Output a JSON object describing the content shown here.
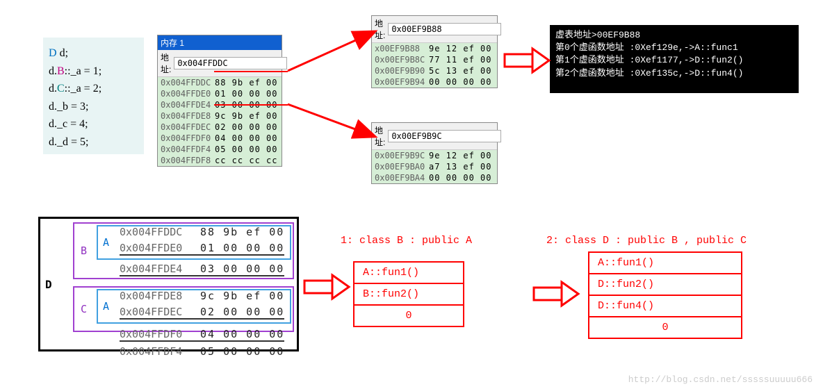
{
  "code": {
    "line1_type": "D",
    "line1_rest": " d;",
    "line2_pre": "d.",
    "line2_cls": "B",
    "line2_rest": "::_a = 1;",
    "line3_pre": "d.",
    "line3_cls": "C",
    "line3_rest": "::_a = 2;",
    "line4": "d._b = 3;",
    "line5": "d._c = 4;",
    "line6": "d._d = 5;"
  },
  "mem1": {
    "title": "内存 1",
    "addr_label": "地址:",
    "addr_value": "0x004FFDDC",
    "rows": [
      {
        "addr": "0x004FFDDC",
        "bytes": "88 9b ef 00"
      },
      {
        "addr": "0x004FFDE0",
        "bytes": "01 00 00 00"
      },
      {
        "addr": "0x004FFDE4",
        "bytes": "03 00 00 00"
      },
      {
        "addr": "0x004FFDE8",
        "bytes": "9c 9b ef 00"
      },
      {
        "addr": "0x004FFDEC",
        "bytes": "02 00 00 00"
      },
      {
        "addr": "0x004FFDF0",
        "bytes": "04 00 00 00"
      },
      {
        "addr": "0x004FFDF4",
        "bytes": "05 00 00 00"
      },
      {
        "addr": "0x004FFDF8",
        "bytes": "cc cc cc cc"
      }
    ]
  },
  "mem2": {
    "addr_label": "地址:",
    "addr_value": "0x00EF9B88",
    "rows": [
      {
        "addr": "x00EF9B88",
        "bytes": "9e 12 ef 00"
      },
      {
        "addr": "0x00EF9B8C",
        "bytes": "77 11 ef 00"
      },
      {
        "addr": "0x00EF9B90",
        "bytes": "5c 13 ef 00"
      },
      {
        "addr": "0x00EF9B94",
        "bytes": "00 00 00 00"
      }
    ]
  },
  "mem3": {
    "addr_label": "地址:",
    "addr_value": "0x00EF9B9C",
    "rows": [
      {
        "addr": "0x00EF9B9C",
        "bytes": "9e 12 ef 00"
      },
      {
        "addr": "0x00EF9BA0",
        "bytes": "a7 13 ef 00"
      },
      {
        "addr": "0x00EF9BA4",
        "bytes": "00 00 00 00"
      }
    ]
  },
  "terminal": {
    "line1": "虚表地址>00EF9B88",
    "line2": "第0个虚函数地址 :0Xef129e,->A::func1",
    "line3": "第1个虚函数地址 :0Xef1177,->D::fun2()",
    "line4": "第2个虚函数地址 :0Xef135c,->D::fun4()"
  },
  "bottom": {
    "label_D": "D",
    "label_B": "B",
    "label_C": "C",
    "label_A": "A",
    "rows": [
      {
        "addr": "0x004FFDDC",
        "bytes": "88 9b ef 00"
      },
      {
        "addr": "0x004FFDE0",
        "bytes": "01 00 00 00"
      },
      {
        "addr": "0x004FFDE4",
        "bytes": "03 00 00 00"
      },
      {
        "addr": "0x004FFDE8",
        "bytes": "9c 9b ef 00"
      },
      {
        "addr": "0x004FFDEC",
        "bytes": "02 00 00 00"
      },
      {
        "addr": "0x004FFDF0",
        "bytes": "04 00 00 00"
      },
      {
        "addr": "0x004FFDF4",
        "bytes": "05 00 00 00"
      }
    ]
  },
  "headings": {
    "h1": "1: class B : public A",
    "h2": "2: class D : public B , public C"
  },
  "vtable1": {
    "r1": "A::fun1()",
    "r2": "B::fun2()",
    "r3": "0"
  },
  "vtable2": {
    "r1": "A::fun1()",
    "r2": "D::fun2()",
    "r3": "D::fun4()",
    "r4": "0"
  },
  "watermark": "http://blog.csdn.net/sssssuuuuu666"
}
